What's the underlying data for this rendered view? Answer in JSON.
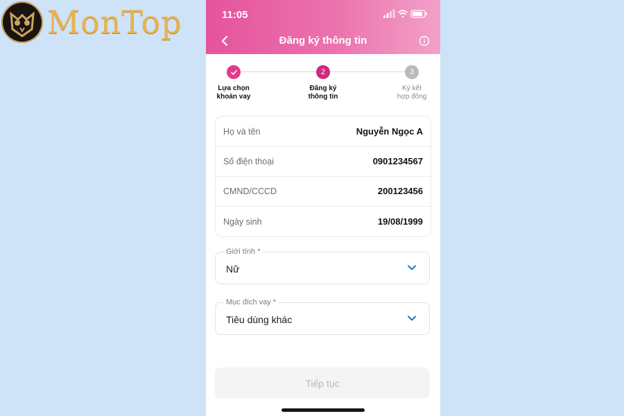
{
  "brand": {
    "logo_text": "MonTop"
  },
  "status_bar": {
    "time": "11:05"
  },
  "header": {
    "title": "Đăng ký thông tin"
  },
  "steps": [
    {
      "number": "1",
      "label_line1": "Lựa chọn",
      "label_line2": "khoản vay",
      "state": "done"
    },
    {
      "number": "2",
      "label_line1": "Đăng ký",
      "label_line2": "thông tin",
      "state": "active"
    },
    {
      "number": "3",
      "label_line1": "Ký kết",
      "label_line2": "hợp đồng",
      "state": "todo"
    }
  ],
  "info_rows": [
    {
      "label": "Họ và tên",
      "value": "Nguyễn Ngọc A"
    },
    {
      "label": "Số điện thoại",
      "value": "0901234567"
    },
    {
      "label": "CMND/CCCD",
      "value": "200123456"
    },
    {
      "label": "Ngày sinh",
      "value": "19/08/1999"
    }
  ],
  "fields": {
    "gender": {
      "label": "Giới tính *",
      "value": "Nữ"
    },
    "purpose": {
      "label": "Mục đích vay *",
      "value": "Tiêu dùng khác"
    }
  },
  "actions": {
    "continue_label": "Tiếp tục"
  },
  "colors": {
    "header_start": "#e5539d",
    "header_end": "#f2a1c8",
    "accent": "#d02a80",
    "chevron": "#1b78c2",
    "page_bg": "#cfe3f8"
  },
  "icons": {
    "back": "chevron-left-icon",
    "info": "info-icon",
    "done": "check-icon",
    "dropdown": "chevron-down-icon"
  }
}
